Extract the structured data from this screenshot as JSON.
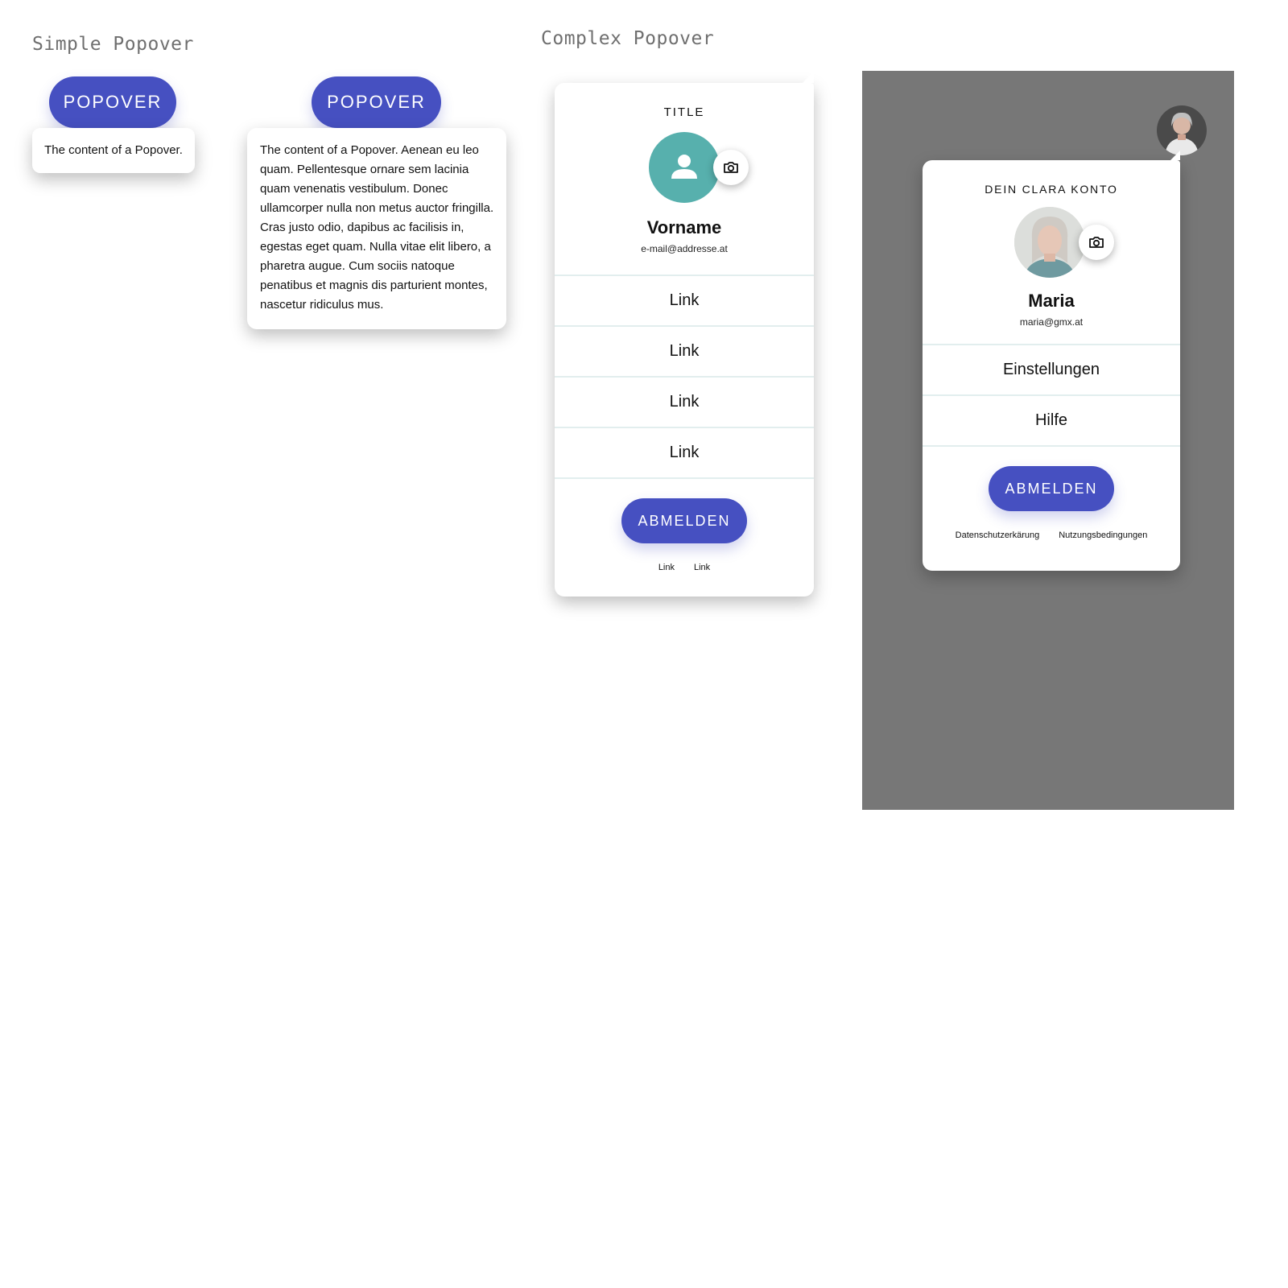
{
  "sections": {
    "simple_title": "Simple Popover",
    "complex_title": "Complex Popover"
  },
  "simple_short": {
    "button_label": "POPOVER",
    "content": "The content of a Popover."
  },
  "simple_long": {
    "button_label": "POPOVER",
    "content": "The content of a Popover. Aenean eu leo quam. Pellentesque ornare sem lacinia quam venenatis vestibulum. Donec ullamcorper nulla non metus auctor fringilla. Cras justo odio, dapibus ac facilisis in, egestas eget quam. Nulla vitae elit libero, a pharetra augue. Cum sociis natoque penatibus et magnis dis parturient montes, nascetur ridiculus mus."
  },
  "complex_template": {
    "title": "TITLE",
    "name": "Vorname",
    "email": "e-mail@addresse.at",
    "links": [
      "Link",
      "Link",
      "Link",
      "Link"
    ],
    "logout_label": "ABMELDEN",
    "footer_links": [
      "Link",
      "Link"
    ],
    "avatar_icon": "person-icon",
    "camera_icon": "camera-icon"
  },
  "complex_example": {
    "title": "DEIN CLARA KONTO",
    "name": "Maria",
    "email": "maria@gmx.at",
    "links": [
      "Einstellungen",
      "Hilfe"
    ],
    "logout_label": "ABMELDEN",
    "footer_links": [
      "Datenschutzerkärung",
      "Nutzungsbedingungen"
    ],
    "camera_icon": "camera-icon"
  },
  "colors": {
    "accent": "#4650c1",
    "avatar_teal": "#57b0ad",
    "overlay": "#777777",
    "divider": "#e2eeee"
  }
}
